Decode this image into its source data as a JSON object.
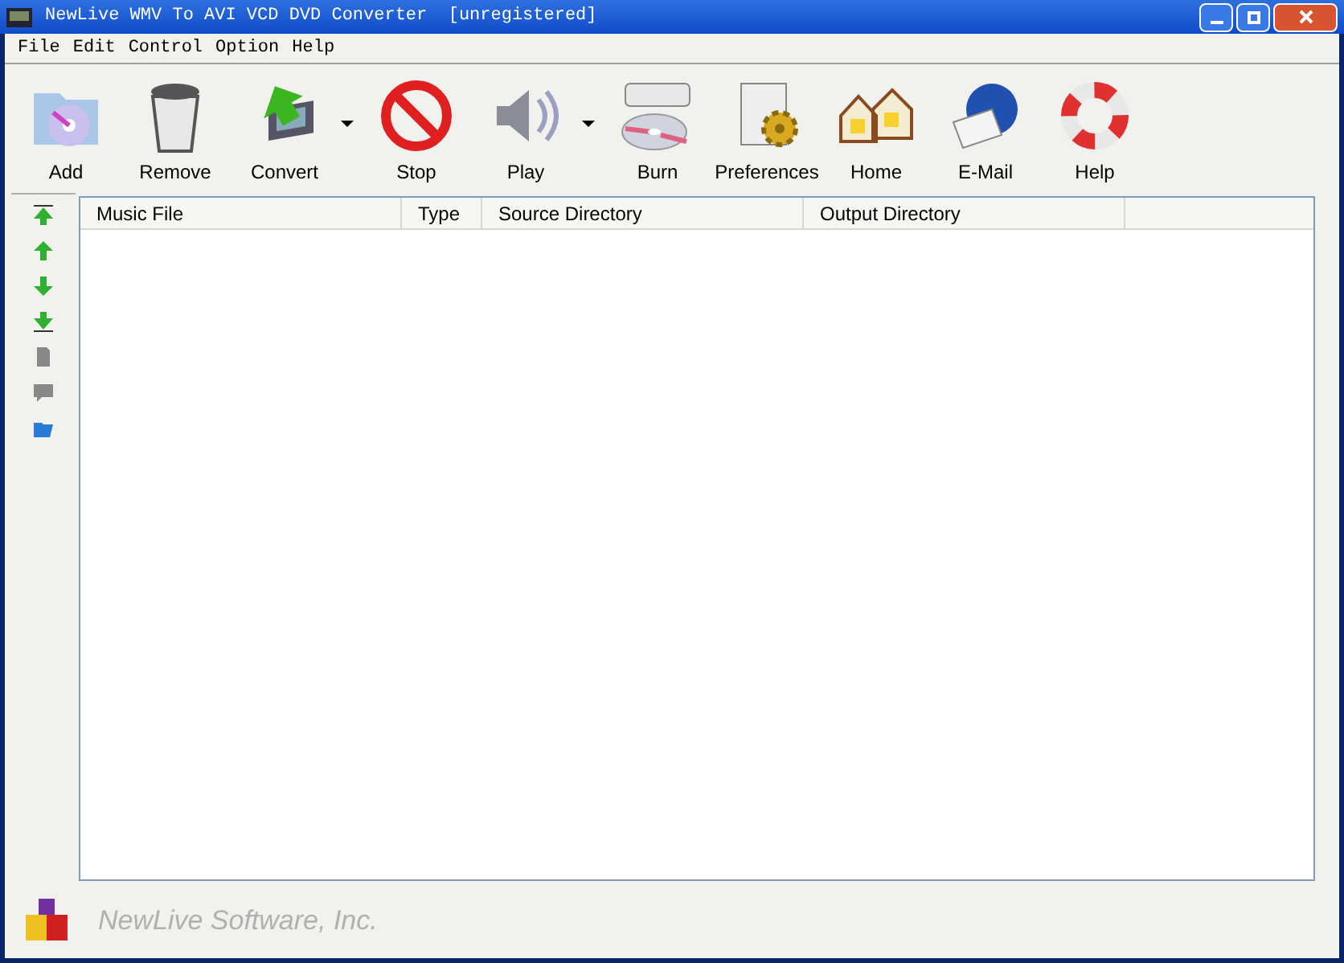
{
  "window": {
    "title": "NewLive WMV To AVI VCD DVD Converter  [unregistered]"
  },
  "menu": [
    "File",
    "Edit",
    "Control",
    "Option",
    "Help"
  ],
  "toolbar": [
    {
      "kind": "add",
      "label": "Add",
      "dropdown": false
    },
    {
      "kind": "remove",
      "label": "Remove",
      "dropdown": false
    },
    {
      "kind": "convert",
      "label": "Convert",
      "dropdown": true
    },
    {
      "kind": "stop",
      "label": "Stop",
      "dropdown": false
    },
    {
      "kind": "play",
      "label": "Play",
      "dropdown": true
    },
    {
      "kind": "burn",
      "label": "Burn",
      "dropdown": false
    },
    {
      "kind": "preferences",
      "label": "Preferences",
      "dropdown": false
    },
    {
      "kind": "home",
      "label": "Home",
      "dropdown": false
    },
    {
      "kind": "email",
      "label": "E-Mail",
      "dropdown": false
    },
    {
      "kind": "help",
      "label": "Help",
      "dropdown": false
    }
  ],
  "side_tools": [
    {
      "kind": "top",
      "disabled": false
    },
    {
      "kind": "up",
      "disabled": false
    },
    {
      "kind": "down",
      "disabled": false
    },
    {
      "kind": "bottom",
      "disabled": false
    },
    {
      "kind": "file",
      "disabled": true
    },
    {
      "kind": "comment",
      "disabled": true
    },
    {
      "kind": "folder",
      "disabled": false
    }
  ],
  "table": {
    "columns": [
      "Music File",
      "Type",
      "Source Directory",
      "Output Directory"
    ]
  },
  "footer": {
    "company": "NewLive Software, Inc."
  }
}
